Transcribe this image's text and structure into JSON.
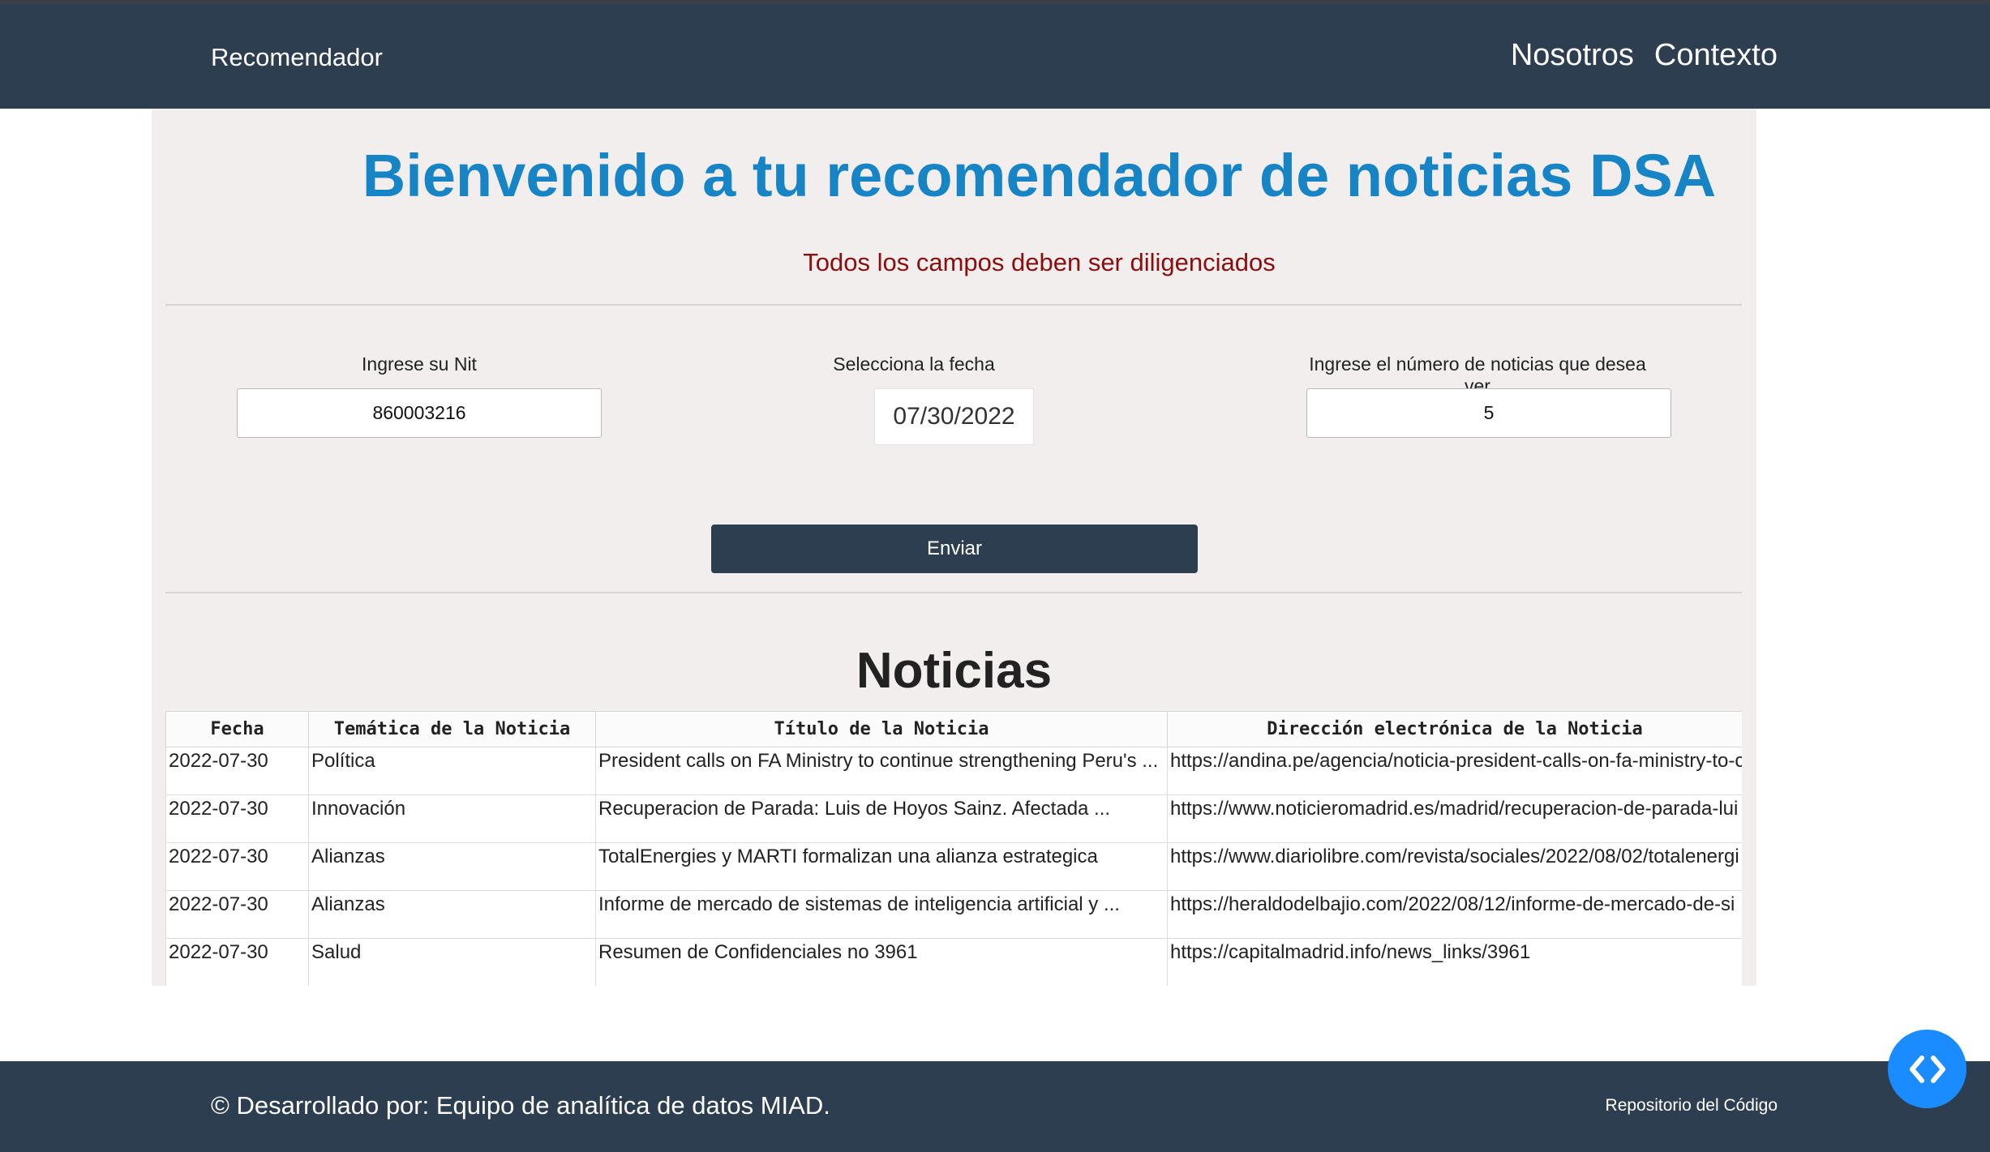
{
  "navbar": {
    "brand": "Recomendador",
    "links": [
      "Nosotros",
      "Contexto"
    ]
  },
  "page": {
    "title": "Bienvenido a tu recomendador de noticias DSA",
    "subtitle": "Todos los campos deben ser diligenciados"
  },
  "form": {
    "nit_label": "Ingrese su Nit",
    "nit_value": "860003216",
    "date_label": "Selecciona la fecha",
    "date_value": "07/30/2022",
    "count_label": "Ingrese el número de noticias que desea ver",
    "count_value": "5",
    "submit_label": "Enviar"
  },
  "news": {
    "heading": "Noticias",
    "columns": [
      "Fecha",
      "Temática de la Noticia",
      "Título de la Noticia",
      "Dirección electrónica de la Noticia"
    ],
    "rows": [
      [
        "2022-07-30",
        "Política",
        "President calls on FA Ministry to continue strengthening Peru's ...",
        "https://andina.pe/agencia/noticia-president-calls-on-fa-ministry-to-c"
      ],
      [
        "2022-07-30",
        "Innovación",
        "Recuperacion de Parada: Luis de Hoyos Sainz. Afectada ...",
        "https://www.noticieromadrid.es/madrid/recuperacion-de-parada-lui"
      ],
      [
        "2022-07-30",
        "Alianzas",
        "TotalEnergies y MARTI formalizan una alianza estrategica",
        "https://www.diariolibre.com/revista/sociales/2022/08/02/totalenergi"
      ],
      [
        "2022-07-30",
        "Alianzas",
        "Informe de mercado de sistemas de inteligencia artificial y ...",
        "https://heraldodelbajio.com/2022/08/12/informe-de-mercado-de-si"
      ],
      [
        "2022-07-30",
        "Salud",
        "Resumen de Confidenciales no 3961",
        "https://capitalmadrid.info/news_links/3961"
      ]
    ]
  },
  "footer": {
    "credit": "© Desarrollado por: Equipo de analítica de datos MIAD.",
    "repo_link": "Repositorio del Código"
  },
  "fab": {
    "icon": "code-brackets-icon"
  },
  "colors": {
    "navbar": "#2c3e50",
    "title": "#1785c5",
    "subtitle": "#8b0d0d",
    "panel": "#f1eeed",
    "fab": "#1a8cff"
  }
}
